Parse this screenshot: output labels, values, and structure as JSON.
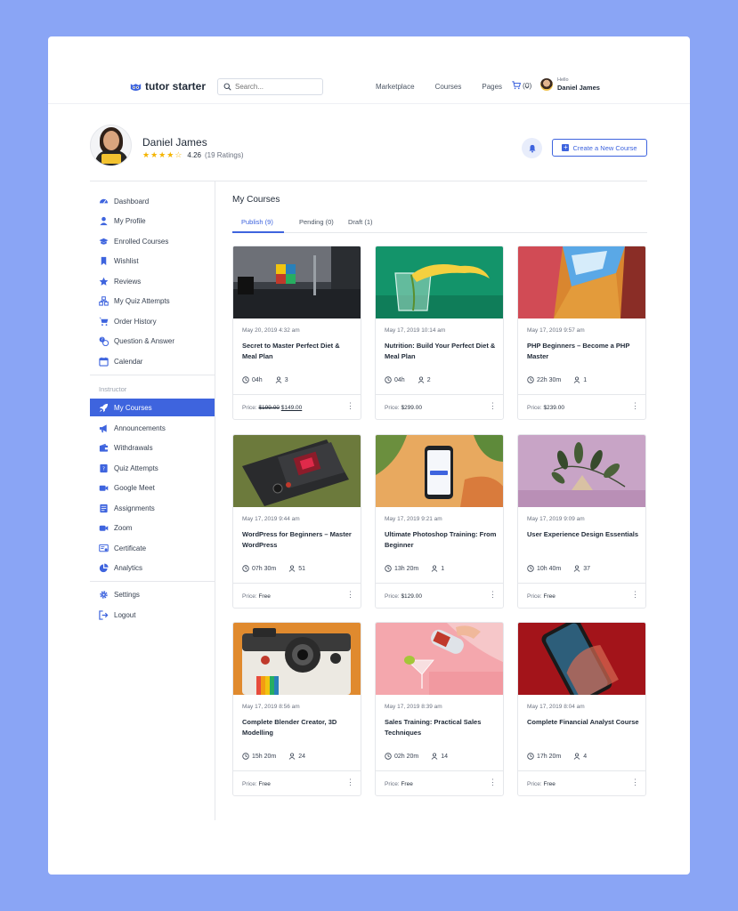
{
  "header": {
    "logo_text": "tutor starter",
    "search_placeholder": "Search...",
    "nav": [
      "Marketplace",
      "Courses",
      "Pages"
    ],
    "cart_count": "(0)",
    "hello_label": "Hello",
    "user_name": "Daniel James"
  },
  "profile": {
    "name": "Daniel James",
    "rating_value": "4.26",
    "rating_count": "(19 Ratings)",
    "stars_filled": 4,
    "stars_total": 5,
    "create_label": "Create a New Course"
  },
  "sidebar": {
    "items": [
      {
        "label": "Dashboard",
        "icon": "dashboard-icon"
      },
      {
        "label": "My Profile",
        "icon": "user-icon"
      },
      {
        "label": "Enrolled Courses",
        "icon": "graduation-cap-icon"
      },
      {
        "label": "Wishlist",
        "icon": "bookmark-icon"
      },
      {
        "label": "Reviews",
        "icon": "star-icon"
      },
      {
        "label": "My Quiz Attempts",
        "icon": "quiz-icon"
      },
      {
        "label": "Order History",
        "icon": "cart-icon"
      },
      {
        "label": "Question & Answer",
        "icon": "question-icon"
      },
      {
        "label": "Calendar",
        "icon": "calendar-icon"
      }
    ],
    "section_label": "Instructor",
    "instructor_items": [
      {
        "label": "My Courses",
        "icon": "rocket-icon"
      },
      {
        "label": "Announcements",
        "icon": "megaphone-icon"
      },
      {
        "label": "Withdrawals",
        "icon": "wallet-icon"
      },
      {
        "label": "Quiz Attempts",
        "icon": "quiz-attempts-icon"
      },
      {
        "label": "Google Meet",
        "icon": "video-icon"
      },
      {
        "label": "Assignments",
        "icon": "assignments-icon"
      },
      {
        "label": "Zoom",
        "icon": "zoom-icon"
      },
      {
        "label": "Certificate",
        "icon": "certificate-icon"
      },
      {
        "label": "Analytics",
        "icon": "pie-chart-icon"
      }
    ],
    "bottom_items": [
      {
        "label": "Settings",
        "icon": "gear-icon"
      },
      {
        "label": "Logout",
        "icon": "logout-icon"
      }
    ]
  },
  "main": {
    "title": "My Courses",
    "tabs": [
      "Publish (9)",
      "Pending (0)",
      "Draft (1)"
    ],
    "price_label": "Price:",
    "courses": [
      {
        "date": "May 20, 2019 4:32 am",
        "title": "Secret to Master Perfect Diet & Meal Plan",
        "duration": "04h",
        "students": "3",
        "price_old": "$199.00",
        "price": "$149.00"
      },
      {
        "date": "May 17, 2019 10:14 am",
        "title": "Nutrition: Build Your Perfect Diet & Meal Plan",
        "duration": "04h",
        "students": "2",
        "price": "$299.00"
      },
      {
        "date": "May 17, 2019 9:57 am",
        "title": "PHP Beginners – Become a PHP Master",
        "duration": "22h  30m",
        "students": "1",
        "price": "$239.00"
      },
      {
        "date": "May 17, 2019 9:44 am",
        "title": "WordPress for Beginners – Master WordPress",
        "duration": "07h  30m",
        "students": "51",
        "price": "Free"
      },
      {
        "date": "May 17, 2019 9:21 am",
        "title": "Ultimate Photoshop Training: From Beginner",
        "duration": "13h  20m",
        "students": "1",
        "price": "$129.00"
      },
      {
        "date": "May 17, 2019 9:09 am",
        "title": "User Experience Design Essentials",
        "duration": "10h  40m",
        "students": "37",
        "price": "Free"
      },
      {
        "date": "May 17, 2019 8:56 am",
        "title": "Complete Blender Creator, 3D Modelling",
        "duration": "15h  20m",
        "students": "24",
        "price": "Free"
      },
      {
        "date": "May 17, 2019 8:39 am",
        "title": "Sales Training: Practical Sales Techniques",
        "duration": "02h  20m",
        "students": "14",
        "price": "Free"
      },
      {
        "date": "May 17, 2019 8:04 am",
        "title": "Complete Financial Analyst Course",
        "duration": "17h  20m",
        "students": "4",
        "price": "Free"
      }
    ]
  },
  "colors": {
    "accent": "#3e64de",
    "star": "#f4b400",
    "background": "#8aa5f5"
  }
}
